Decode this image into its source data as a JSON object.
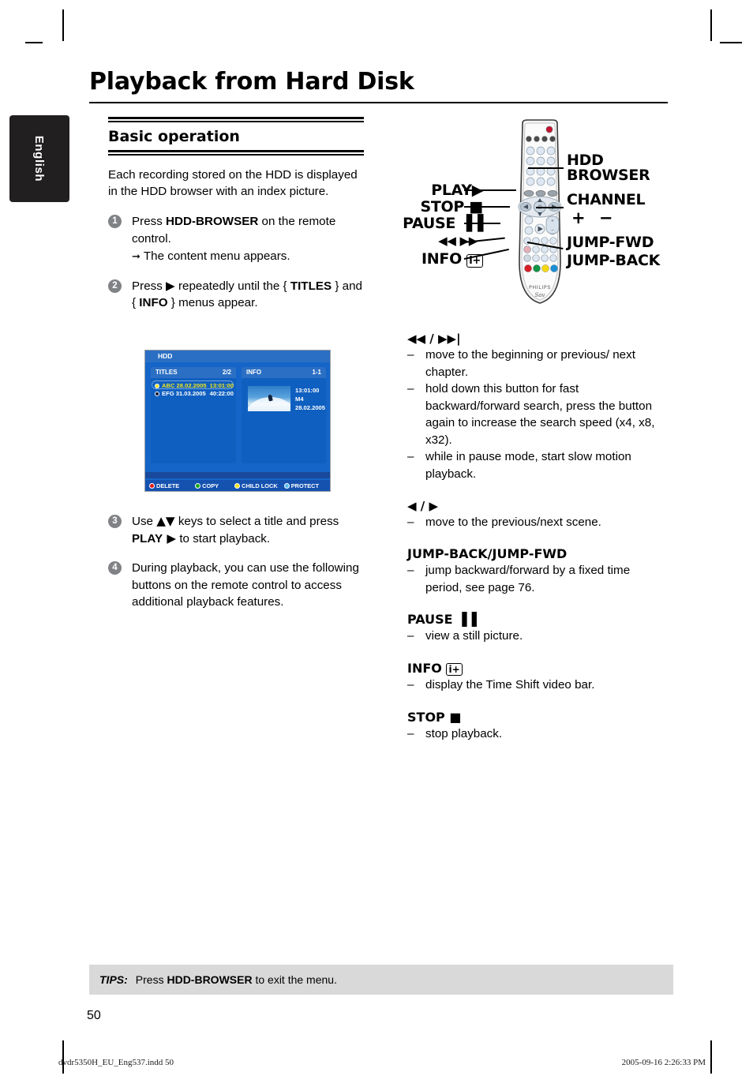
{
  "page": {
    "title": "Playback from Hard Disk",
    "language_tab": "English",
    "page_number": "50"
  },
  "left_column": {
    "section_title": "Basic operation",
    "intro": "Each recording stored on the HDD is displayed in the HDD browser with an index picture.",
    "steps": [
      {
        "num": "1",
        "text_before": "Press ",
        "bold": "HDD-BROWSER",
        "text_after": " on the remote control.",
        "sub": "The content menu appears."
      },
      {
        "num": "2",
        "part1": "Press ",
        "sym1": "▶",
        "part2": " repeatedly until the { ",
        "bold1": "TITLES",
        "part3": " } and { ",
        "bold2": "INFO",
        "part4": " } menus appear."
      },
      {
        "num": "3",
        "part1": "Use ",
        "sym1": "▲▼",
        "part2": " keys to select a title and press ",
        "bold1": "PLAY",
        "sym2": " ▶",
        "part3": " to start playback."
      },
      {
        "num": "4",
        "text": "During playback, you can use the following buttons on the remote control to access additional playback features."
      }
    ]
  },
  "osd": {
    "top_label": "HDD",
    "titles_panel": {
      "header": "TITLES",
      "count": "2/2",
      "rows": [
        {
          "name": "ABC 28.02.2005",
          "time": "13:01:00",
          "selected": true
        },
        {
          "name": "EFG 31.03.2005",
          "time": "40:22:00",
          "selected": false
        }
      ]
    },
    "info_panel": {
      "header": "INFO",
      "count": "1-1",
      "lines": [
        "13:01:00",
        "M4",
        "28.02.2005"
      ]
    },
    "color_keys": [
      {
        "label": "DELETE",
        "color": "#e21b1b"
      },
      {
        "label": "COPY",
        "color": "#19a519"
      },
      {
        "label": "CHILD LOCK",
        "color": "#f2e51c"
      },
      {
        "label": "PROTECT",
        "color": "#55bdf0"
      }
    ]
  },
  "remote": {
    "brand": "PHILIPS",
    "labels": {
      "play": "PLAY",
      "play_sym": "▶",
      "stop": "STOP",
      "stop_sym": "■",
      "pause": "PAUSE",
      "pause_sym": "▐▐",
      "skip": "◀◀  ▶▶",
      "info": "INFO",
      "info_sym": "i+",
      "hdd": "HDD",
      "browser": "BROWSER",
      "channel": "CHANNEL",
      "plus_minus": "+ −",
      "jump_fwd": "JUMP-FWD",
      "jump_back": "JUMP-BACK"
    }
  },
  "right_column": {
    "blocks": [
      {
        "heading": "◀◀ / ▶▶|",
        "heading_is_symbol": true,
        "items": [
          "move to the beginning or previous/ next chapter.",
          "hold down this button for fast backward/forward search, press the button again to increase the search speed (x4, x8, x32).",
          "while in pause mode, start slow motion playback."
        ]
      },
      {
        "heading": "◀ / ▶",
        "heading_is_symbol": true,
        "items": [
          "move to the previous/next scene."
        ]
      },
      {
        "heading": "JUMP-BACK/JUMP-FWD",
        "heading_is_symbol": false,
        "items": [
          "jump backward/forward by a fixed time period, see page 76."
        ]
      },
      {
        "heading": "PAUSE",
        "heading_sym": "▐▐",
        "heading_is_symbol": false,
        "items": [
          "view a still picture."
        ]
      },
      {
        "heading": "INFO",
        "heading_sym": "i+",
        "heading_is_symbol": false,
        "items": [
          "display the Time Shift video bar."
        ]
      },
      {
        "heading": "STOP",
        "heading_sym": "■",
        "heading_is_symbol": false,
        "items": [
          "stop playback."
        ]
      }
    ]
  },
  "tips": {
    "label": "TIPS:",
    "text_before": "Press ",
    "bold": "HDD-BROWSER",
    "text_after": " to exit the menu."
  },
  "print_footer": {
    "file": "dvdr5350H_EU_Eng537.indd   50",
    "timestamp": "2005-09-16   2:26:33 PM"
  }
}
